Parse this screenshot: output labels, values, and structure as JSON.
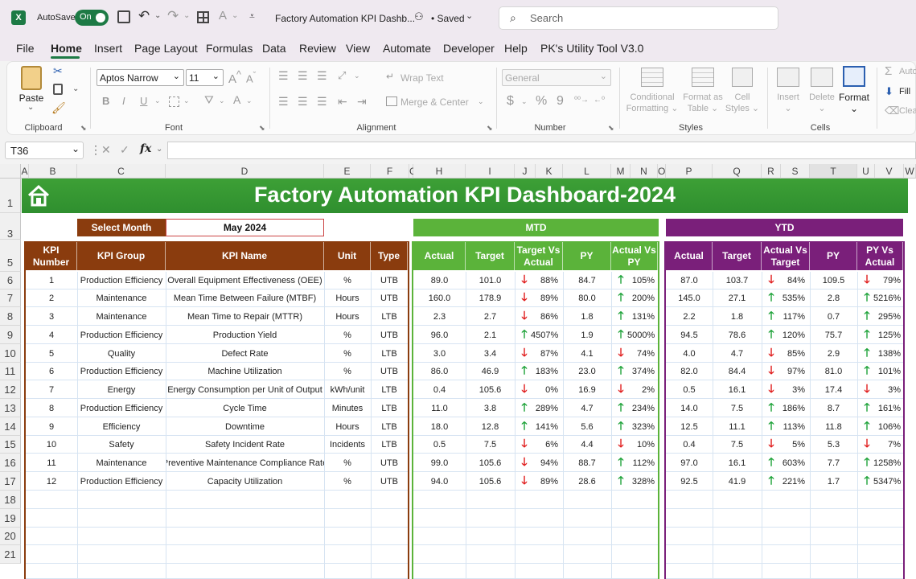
{
  "titlebar": {
    "autosave_label": "AutoSave",
    "autosave_state": "On",
    "file_name": "Factory Automation KPI Dashb...",
    "saved_label": "• Saved",
    "search_placeholder": "Search"
  },
  "menu": [
    "File",
    "Home",
    "Insert",
    "Page Layout",
    "Formulas",
    "Data",
    "Review",
    "View",
    "Automate",
    "Developer",
    "Help",
    "PK's Utility Tool V3.0"
  ],
  "ribbon": {
    "paste": "Paste",
    "clipboard": "Clipboard",
    "font_name": "Aptos Narrow",
    "font_size": "11",
    "font": "Font",
    "wrap_text": "Wrap Text",
    "merge_center": "Merge & Center",
    "alignment": "Alignment",
    "number_format": "General",
    "number": "Number",
    "conditional_formatting": [
      "Conditional",
      "Formatting"
    ],
    "format_as_table": [
      "Format as",
      "Table"
    ],
    "cell_styles": [
      "Cell",
      "Styles"
    ],
    "styles": "Styles",
    "insert": "Insert",
    "delete": "Delete",
    "format": "Format",
    "cells": "Cells",
    "autosum": "Auto",
    "fill": "Fill",
    "clear": "Clea"
  },
  "formula_bar": {
    "name_box": "T36",
    "fx": "fx",
    "formula": ""
  },
  "columns": [
    "A",
    "B",
    "C",
    "D",
    "E",
    "F",
    "G",
    "H",
    "I",
    "J",
    "K",
    "L",
    "M",
    "N",
    "O",
    "P",
    "Q",
    "R",
    "S",
    "T",
    "U",
    "V",
    "W"
  ],
  "rows": [
    "1",
    "3",
    "5",
    "6",
    "7",
    "8",
    "9",
    "10",
    "11",
    "12",
    "13",
    "14",
    "15",
    "16",
    "17",
    "18",
    "19",
    "20",
    "21"
  ],
  "dashboard": {
    "title": "Factory Automation KPI Dashboard-2024",
    "select_month_label": "Select Month",
    "selected_month": "May 2024",
    "mtd_label": "MTD",
    "ytd_label": "YTD",
    "main_headers": [
      "KPI Number",
      "KPI Group",
      "KPI Name",
      "Unit",
      "Type"
    ],
    "mtd_headers": [
      "Actual",
      "Target",
      "Target Vs Actual",
      "PY",
      "Actual Vs PY"
    ],
    "ytd_headers": [
      "Actual",
      "Target",
      "Actual Vs Target",
      "PY",
      "PY Vs Actual"
    ],
    "colors": {
      "title_green": "#2f8f2f",
      "brown": "#8a3c0e",
      "mtd_green": "#5bb33a",
      "ytd_purple": "#7a1f7a",
      "up_arrow": "#1fa33a",
      "down_arrow": "#e01b1b"
    },
    "kpis": [
      {
        "num": "1",
        "group": "Production Efficiency",
        "name": "Overall Equipment Effectiveness (OEE)",
        "unit": "%",
        "type": "UTB",
        "mtd": {
          "actual": "89.0",
          "target": "101.0",
          "tva_dir": "down",
          "tva": "88%",
          "py": "84.7",
          "avp_dir": "up",
          "avp": "105%"
        },
        "ytd": {
          "actual": "87.0",
          "target": "103.7",
          "avt_dir": "down",
          "avt": "84%",
          "py": "109.5",
          "pva_dir": "down",
          "pva": "79%"
        }
      },
      {
        "num": "2",
        "group": "Maintenance",
        "name": "Mean Time Between Failure (MTBF)",
        "unit": "Hours",
        "type": "UTB",
        "mtd": {
          "actual": "160.0",
          "target": "178.9",
          "tva_dir": "down",
          "tva": "89%",
          "py": "80.0",
          "avp_dir": "up",
          "avp": "200%"
        },
        "ytd": {
          "actual": "145.0",
          "target": "27.1",
          "avt_dir": "up",
          "avt": "535%",
          "py": "2.8",
          "pva_dir": "up",
          "pva": "5216%"
        }
      },
      {
        "num": "3",
        "group": "Maintenance",
        "name": "Mean Time to Repair (MTTR)",
        "unit": "Hours",
        "type": "LTB",
        "mtd": {
          "actual": "2.3",
          "target": "2.7",
          "tva_dir": "down",
          "tva": "86%",
          "py": "1.8",
          "avp_dir": "up",
          "avp": "131%"
        },
        "ytd": {
          "actual": "2.2",
          "target": "1.8",
          "avt_dir": "up",
          "avt": "117%",
          "py": "0.7",
          "pva_dir": "up",
          "pva": "295%"
        }
      },
      {
        "num": "4",
        "group": "Production Efficiency",
        "name": "Production Yield",
        "unit": "%",
        "type": "UTB",
        "mtd": {
          "actual": "96.0",
          "target": "2.1",
          "tva_dir": "up",
          "tva": "4507%",
          "py": "1.9",
          "avp_dir": "up",
          "avp": "5000%"
        },
        "ytd": {
          "actual": "94.5",
          "target": "78.6",
          "avt_dir": "up",
          "avt": "120%",
          "py": "75.7",
          "pva_dir": "up",
          "pva": "125%"
        }
      },
      {
        "num": "5",
        "group": "Quality",
        "name": "Defect Rate",
        "unit": "%",
        "type": "LTB",
        "mtd": {
          "actual": "3.0",
          "target": "3.4",
          "tva_dir": "down",
          "tva": "87%",
          "py": "4.1",
          "avp_dir": "down",
          "avp": "74%"
        },
        "ytd": {
          "actual": "4.0",
          "target": "4.7",
          "avt_dir": "down",
          "avt": "85%",
          "py": "2.9",
          "pva_dir": "up",
          "pva": "138%"
        }
      },
      {
        "num": "6",
        "group": "Production Efficiency",
        "name": "Machine Utilization",
        "unit": "%",
        "type": "UTB",
        "mtd": {
          "actual": "86.0",
          "target": "46.9",
          "tva_dir": "up",
          "tva": "183%",
          "py": "23.0",
          "avp_dir": "up",
          "avp": "374%"
        },
        "ytd": {
          "actual": "82.0",
          "target": "84.4",
          "avt_dir": "down",
          "avt": "97%",
          "py": "81.0",
          "pva_dir": "up",
          "pva": "101%"
        }
      },
      {
        "num": "7",
        "group": "Energy",
        "name": "Energy Consumption per Unit of Output",
        "unit": "kWh/unit",
        "type": "LTB",
        "mtd": {
          "actual": "0.4",
          "target": "105.6",
          "tva_dir": "down",
          "tva": "0%",
          "py": "16.9",
          "avp_dir": "down",
          "avp": "2%"
        },
        "ytd": {
          "actual": "0.5",
          "target": "16.1",
          "avt_dir": "down",
          "avt": "3%",
          "py": "17.4",
          "pva_dir": "down",
          "pva": "3%"
        }
      },
      {
        "num": "8",
        "group": "Production Efficiency",
        "name": "Cycle Time",
        "unit": "Minutes",
        "type": "LTB",
        "mtd": {
          "actual": "11.0",
          "target": "3.8",
          "tva_dir": "up",
          "tva": "289%",
          "py": "4.7",
          "avp_dir": "up",
          "avp": "234%"
        },
        "ytd": {
          "actual": "14.0",
          "target": "7.5",
          "avt_dir": "up",
          "avt": "186%",
          "py": "8.7",
          "pva_dir": "up",
          "pva": "161%"
        }
      },
      {
        "num": "9",
        "group": "Efficiency",
        "name": "Downtime",
        "unit": "Hours",
        "type": "LTB",
        "mtd": {
          "actual": "18.0",
          "target": "12.8",
          "tva_dir": "up",
          "tva": "141%",
          "py": "5.6",
          "avp_dir": "up",
          "avp": "323%"
        },
        "ytd": {
          "actual": "12.5",
          "target": "11.1",
          "avt_dir": "up",
          "avt": "113%",
          "py": "11.8",
          "pva_dir": "up",
          "pva": "106%"
        }
      },
      {
        "num": "10",
        "group": "Safety",
        "name": "Safety Incident Rate",
        "unit": "Incidents",
        "type": "LTB",
        "mtd": {
          "actual": "0.5",
          "target": "7.5",
          "tva_dir": "down",
          "tva": "6%",
          "py": "4.4",
          "avp_dir": "down",
          "avp": "10%"
        },
        "ytd": {
          "actual": "0.4",
          "target": "7.5",
          "avt_dir": "down",
          "avt": "5%",
          "py": "5.3",
          "pva_dir": "down",
          "pva": "7%"
        }
      },
      {
        "num": "11",
        "group": "Maintenance",
        "name": "Preventive Maintenance Compliance Rate",
        "unit": "%",
        "type": "UTB",
        "mtd": {
          "actual": "99.0",
          "target": "105.6",
          "tva_dir": "down",
          "tva": "94%",
          "py": "88.7",
          "avp_dir": "up",
          "avp": "112%"
        },
        "ytd": {
          "actual": "97.0",
          "target": "16.1",
          "avt_dir": "up",
          "avt": "603%",
          "py": "7.7",
          "pva_dir": "up",
          "pva": "1258%"
        }
      },
      {
        "num": "12",
        "group": "Production Efficiency",
        "name": "Capacity Utilization",
        "unit": "%",
        "type": "UTB",
        "mtd": {
          "actual": "94.0",
          "target": "105.6",
          "tva_dir": "down",
          "tva": "89%",
          "py": "28.6",
          "avp_dir": "up",
          "avp": "328%"
        },
        "ytd": {
          "actual": "92.5",
          "target": "41.9",
          "avt_dir": "up",
          "avt": "221%",
          "py": "1.7",
          "pva_dir": "up",
          "pva": "5347%"
        }
      }
    ]
  }
}
